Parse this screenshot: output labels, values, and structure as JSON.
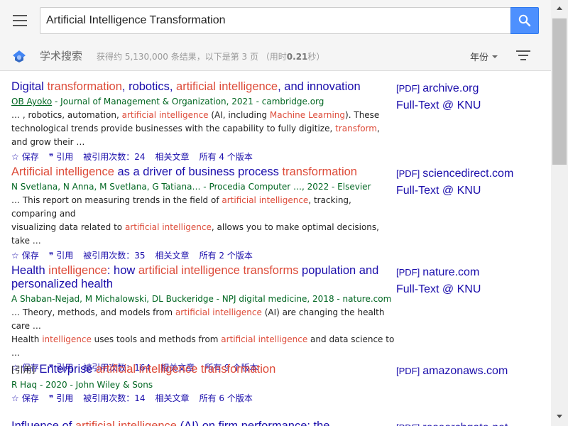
{
  "search": {
    "query": "Artificial Intelligence Transformation"
  },
  "subbar": {
    "scholar_label": "学术搜索",
    "stats_prefix": "获得约 5,130,000 条结果，以下是第 3 页 （用时",
    "stats_time": "0.21",
    "stats_suffix": "秒）",
    "year_label": "年份"
  },
  "icons": {
    "menu": "hamburger-menu-icon",
    "search": "search-icon",
    "logo": "scholar-logo-icon",
    "filter": "filter-icon",
    "save": "star-icon",
    "cite": "quote-icon"
  },
  "colors": {
    "link": "#1a0dab",
    "highlight": "#dd4b39",
    "meta": "#006621",
    "search_button": "#4d90fe"
  },
  "actions": {
    "save": "保存",
    "cite": "引用",
    "related": "相关文章"
  },
  "results": [
    {
      "title_parts": [
        {
          "t": "Digital ",
          "hl": false
        },
        {
          "t": "transformation",
          "hl": true
        },
        {
          "t": ", robotics, ",
          "hl": false
        },
        {
          "t": "artificial intelligence",
          "hl": true
        },
        {
          "t": ", and innovation",
          "hl": false
        }
      ],
      "meta_author": "OB Ayoko",
      "meta_rest": " - Journal of Management & Organization, 2021 - cambridge.org",
      "snippet_lines": [
        [
          {
            "t": "… , robotics, automation, ",
            "hl": false
          },
          {
            "t": "artificial intelligence",
            "hl": true
          },
          {
            "t": " (AI, including ",
            "hl": false
          },
          {
            "t": "Machine Learning",
            "hl": true
          },
          {
            "t": "). These",
            "hl": false
          }
        ],
        [
          {
            "t": "technological trends provide businesses with the capability to fully digitize, ",
            "hl": false
          },
          {
            "t": "transform",
            "hl": true
          },
          {
            "t": ", and grow their …",
            "hl": false
          }
        ]
      ],
      "cited_by": "被引用次数：24",
      "versions": "所有 4 个版本",
      "side_links": [
        {
          "tag": "[PDF]",
          "text": "archive.org"
        },
        {
          "tag": "",
          "text": "Full-Text @ KNU"
        }
      ]
    },
    {
      "title_parts": [
        {
          "t": "Artificial intelligence",
          "hl": true
        },
        {
          "t": " as a driver of business process ",
          "hl": false
        },
        {
          "t": "transformation",
          "hl": true
        }
      ],
      "meta_author": "",
      "meta_rest": "N Svetlana, N Anna, M Svetlana, G Tatiana… - Procedia Computer …, 2022 - Elsevier",
      "snippet_lines": [
        [
          {
            "t": "… This report on measuring trends in the field of ",
            "hl": false
          },
          {
            "t": "artificial intelligence",
            "hl": true
          },
          {
            "t": ", tracking, comparing and",
            "hl": false
          }
        ],
        [
          {
            "t": "visualizing data related to ",
            "hl": false
          },
          {
            "t": "artificial intelligence",
            "hl": true
          },
          {
            "t": ", allows you to make optimal decisions, take …",
            "hl": false
          }
        ]
      ],
      "cited_by": "被引用次数：35",
      "versions": "所有 2 个版本",
      "side_links": [
        {
          "tag": "[PDF]",
          "text": "sciencedirect.com"
        },
        {
          "tag": "",
          "text": "Full-Text @ KNU"
        }
      ]
    },
    {
      "title_parts": [
        {
          "t": "Health ",
          "hl": false
        },
        {
          "t": "intelligence",
          "hl": true
        },
        {
          "t": ": how ",
          "hl": false
        },
        {
          "t": "artificial intelligence transforms",
          "hl": true
        },
        {
          "t": " population and personalized health",
          "hl": false
        }
      ],
      "meta_author": "",
      "meta_rest": "A Shaban-Nejad, M Michalowski, DL Buckeridge - NPJ digital medicine, 2018 - nature.com",
      "snippet_lines": [
        [
          {
            "t": "… Theory, methods, and models from ",
            "hl": false
          },
          {
            "t": "artificial intelligence",
            "hl": true
          },
          {
            "t": " (AI) are changing the health care …",
            "hl": false
          }
        ],
        [
          {
            "t": "Health ",
            "hl": false
          },
          {
            "t": "intelligence",
            "hl": true
          },
          {
            "t": " uses tools and methods from ",
            "hl": false
          },
          {
            "t": "artificial intelligence",
            "hl": true
          },
          {
            "t": " and data science to …",
            "hl": false
          }
        ]
      ],
      "cited_by": "被引用次数：164",
      "versions": "所有 9 个版本",
      "side_links": [
        {
          "tag": "[PDF]",
          "text": "nature.com"
        },
        {
          "tag": "",
          "text": "Full-Text @ KNU"
        }
      ]
    },
    {
      "cite_tag": "[引用]",
      "title_parts": [
        {
          "t": "Enterprise ",
          "hl": false
        },
        {
          "t": "artificial intelligence transformation",
          "hl": true
        }
      ],
      "meta_author": "",
      "meta_rest": "R Haq - 2020 - John Wiley & Sons",
      "snippet_lines": [],
      "cited_by": "被引用次数：14",
      "versions": "所有 6 个版本",
      "side_links": [
        {
          "tag": "[PDF]",
          "text": "amazonaws.com"
        }
      ]
    },
    {
      "title_parts": [
        {
          "t": "Influence of ",
          "hl": false
        },
        {
          "t": "artificial intelligence",
          "hl": true
        },
        {
          "t": " (AI) on firm performance: the",
          "hl": false
        }
      ],
      "meta_author": "",
      "meta_rest": "",
      "snippet_lines": [],
      "cited_by": "",
      "versions": "",
      "side_links": [
        {
          "tag": "[PDF]",
          "text": "researchgate.net"
        }
      ]
    }
  ]
}
